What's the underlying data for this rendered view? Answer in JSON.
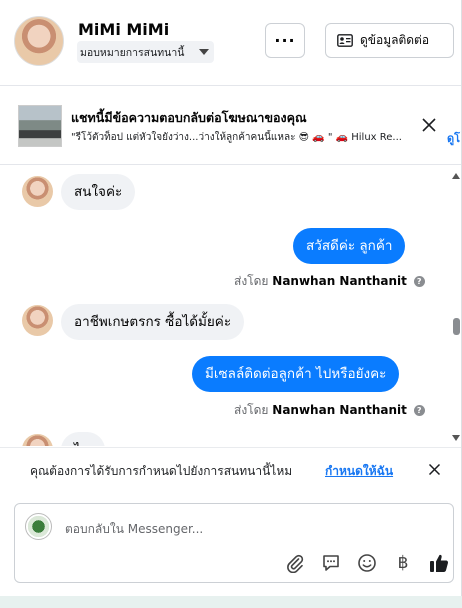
{
  "header": {
    "name": "MiMi MiMi",
    "assign_label": "มอบหมายการสนทนานี้",
    "more_label": "···",
    "contact_label": "ดูข้อมูลติดต่อ"
  },
  "ad_banner": {
    "title": "แชทนี้มีข้อความตอบกลับต่อโฆษณาของคุณ",
    "subtitle": "\"รีโว้ตัวท็อป แต่หัวใจยังว่าง...ว่างให้ลูกค้าคนนี้แหละ 😎 🚗 \" 🚗 Hilux Re...",
    "link": "ดูโ"
  },
  "messages": [
    {
      "direction": "incoming",
      "text": "สนใจค่ะ"
    },
    {
      "direction": "outgoing",
      "text": "สวัสดีค่ะ ลูกค้า"
    },
    {
      "direction": "outgoing",
      "text": "อาชีพเกษตรกร ซื้อได้มั้ยค่ะ"
    },
    {
      "direction": "outgoing",
      "text": "มีเซลล์ติดต่อลูกค้า ไปหรือยังคะ"
    }
  ],
  "thread": {
    "msg1": "สนใจค่ะ",
    "msg2": "สวัสดีค่ะ  ลูกค้า",
    "sent_by_prefix": "ส่งโดย",
    "sent_by_name": "Nanwhan Nanthanit",
    "msg3": "อาชีพเกษตรกร ซื้อได้มั้ยค่ะ",
    "msg4": "มีเซลล์ติดต่อลูกค้า ไปหรือยังคะ",
    "msg5_partial": "ไ ร"
  },
  "assign_prompt": {
    "text": "คุณต้องการได้รับการกำหนดไปยังการสนทนานี้ไหม",
    "action": "กำหนดให้ฉัน"
  },
  "composer": {
    "placeholder": "ตอบกลับใน Messenger...",
    "tools": [
      "paperclip-icon",
      "chat-icon",
      "smiley-icon",
      "baht-icon",
      "thumbs-up-icon"
    ]
  },
  "colors": {
    "accent": "#1877f2",
    "outgoing_bubble": "#0a7cff",
    "incoming_bubble": "#f0f2f5"
  }
}
